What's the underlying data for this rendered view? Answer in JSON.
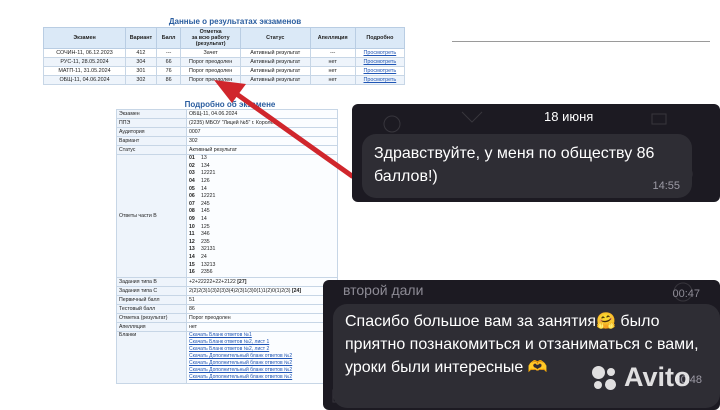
{
  "results": {
    "title": "Данные о результатах экзаменов",
    "headers": [
      "Экзамен",
      "Вариант",
      "Балл",
      "Отметка\nза всю работу\n(результат)",
      "Статус",
      "Апелляция",
      "Подробно"
    ],
    "rows": [
      {
        "exam": "СОЧИН-11, 06.12.2023",
        "variant": "412",
        "score": "---",
        "mark": "Зачет",
        "status": "Активный результат",
        "appeal": "---",
        "details": "Просмотреть"
      },
      {
        "exam": "РУС-11, 28.05.2024",
        "variant": "304",
        "score": "66",
        "mark": "Порог преодолен",
        "status": "Активный результат",
        "appeal": "нет",
        "details": "Просмотреть"
      },
      {
        "exam": "МАТП-11, 31.05.2024",
        "variant": "301",
        "score": "76",
        "mark": "Порог преодолен",
        "status": "Активный результат",
        "appeal": "нет",
        "details": "Просмотреть"
      },
      {
        "exam": "ОБЩ-11, 04.06.2024",
        "variant": "302",
        "score": "86",
        "mark": "Порог преодолен",
        "status": "Активный результат",
        "appeal": "нет",
        "details": "Просмотреть"
      }
    ]
  },
  "detail": {
    "title": "Подробно об экзамене",
    "rows": [
      {
        "k": "Экзамен",
        "v": "ОБЩ-11, 04.06.2024"
      },
      {
        "k": "ППЭ",
        "v": "(2235) МБОУ \"Лицей №5\" г. Королёв"
      },
      {
        "k": "Аудитория",
        "v": "0007"
      },
      {
        "k": "Вариант",
        "v": "302"
      },
      {
        "k": "Статус",
        "v": "Активный результат"
      }
    ],
    "answers_label": "Ответы части B",
    "answers": [
      {
        "n": "01",
        "v": "13"
      },
      {
        "n": "02",
        "v": "134"
      },
      {
        "n": "03",
        "v": "12221"
      },
      {
        "n": "04",
        "v": "126"
      },
      {
        "n": "05",
        "v": "14"
      },
      {
        "n": "06",
        "v": "12221"
      },
      {
        "n": "07",
        "v": "245"
      },
      {
        "n": "08",
        "v": "145"
      },
      {
        "n": "09",
        "v": "14"
      },
      {
        "n": "10",
        "v": "125"
      },
      {
        "n": "11",
        "v": "346"
      },
      {
        "n": "12",
        "v": "235"
      },
      {
        "n": "13",
        "v": "32131"
      },
      {
        "n": "14",
        "v": "24"
      },
      {
        "n": "15",
        "v": "13213"
      },
      {
        "n": "16",
        "v": "2356"
      }
    ],
    "rows2": [
      {
        "k": "Задания типа В",
        "v": "+2+22222+22+2122",
        "b": "[27]"
      },
      {
        "k": "Задания типа С",
        "v": "2(2)2(3)1(3)2(3)3(4)2(3)1(3)0(1)1(2)0(1)2(3)",
        "b": "[24]"
      },
      {
        "k": "Первичный балл",
        "v": "51",
        "b": ""
      },
      {
        "k": "Тестовый балл",
        "v": "86",
        "b": ""
      },
      {
        "k": "Отметка (результат)",
        "v": "Порог преодолен",
        "b": ""
      },
      {
        "k": "Апелляция",
        "v": "нет",
        "b": ""
      }
    ],
    "blanks_label": "Бланки",
    "blanks": [
      "Скачать Бланк ответов №1",
      "Скачать Бланк ответов №2, лист 1",
      "Скачать Бланк ответов №2, лист 2",
      "Скачать Дополнительный бланк ответов №2",
      "Скачать Дополнительный бланк ответов №2",
      "Скачать Дополнительный бланк ответов №2",
      "Скачать Дополнительный бланк ответов №2"
    ]
  },
  "chat1": {
    "date": "18 июня",
    "text": "Здравствуйте, у меня по обществу 86 баллов!)",
    "time": "14:55"
  },
  "chat2": {
    "cut_text": "второй дали",
    "cut_time": "00:47",
    "text": "Спасибо большое вам за занятия🤗 было приятно познакомиться и отзаниматься с вами, уроки были интересные 🫶",
    "time": "00:48"
  },
  "watermark": {
    "text": "Avito"
  },
  "colors": {
    "arrow": "#d0262c",
    "header_bg": "#dbe9f7",
    "link": "#1f55b5",
    "chat_bg": "#1c1a22",
    "bubble": "#2e2d34"
  }
}
